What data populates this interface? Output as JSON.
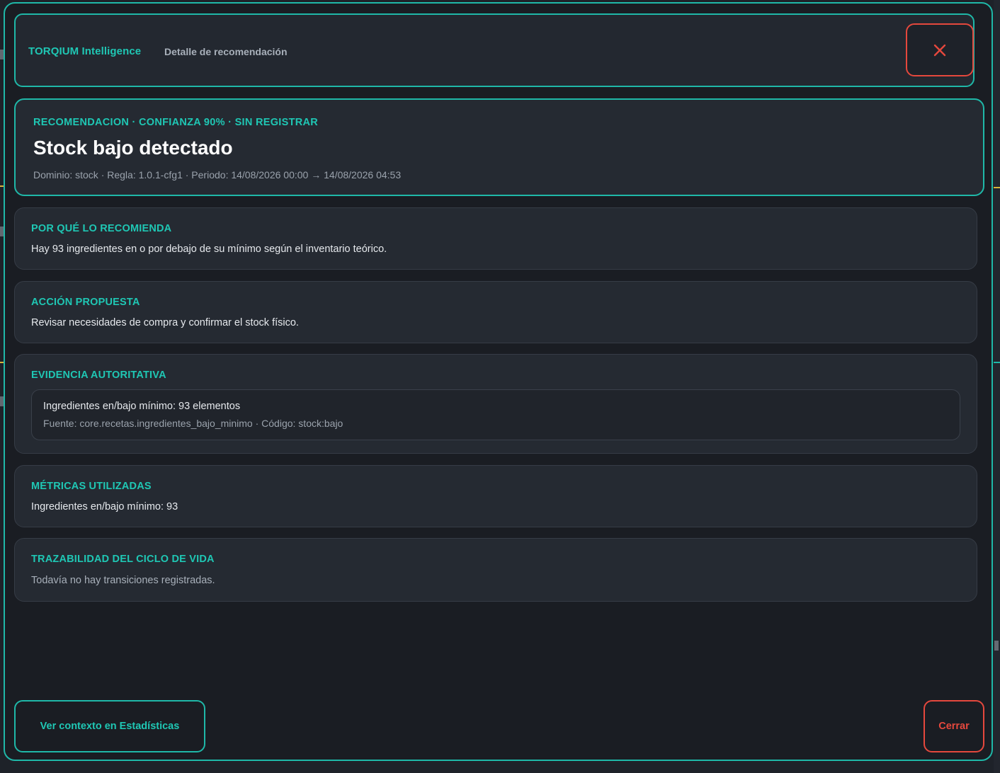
{
  "header": {
    "brand": "TORQIUM Intelligence",
    "subtitle": "Detalle de recomendación",
    "close_icon": "close-icon"
  },
  "recommendation": {
    "meta": "RECOMENDACION · CONFIANZA 90% · SIN REGISTRAR",
    "title": "Stock bajo detectado",
    "detail": "Dominio: stock · Regla: 1.0.1-cfg1 · Periodo: 14/08/2026 00:00 → 14/08/2026 04:53"
  },
  "sections": {
    "why": {
      "title": "POR QUÉ LO RECOMIENDA",
      "body": "Hay 93 ingredientes en o por debajo de su mínimo según el inventario teórico."
    },
    "action": {
      "title": "ACCIÓN PROPUESTA",
      "body": "Revisar necesidades de compra y confirmar el stock físico."
    },
    "evidence": {
      "title": "EVIDENCIA AUTORITATIVA",
      "main": "Ingredientes en/bajo mínimo: 93 elementos",
      "sub": "Fuente: core.recetas.ingredientes_bajo_minimo · Código: stock:bajo"
    },
    "metrics": {
      "title": "MÉTRICAS UTILIZADAS",
      "body": "Ingredientes en/bajo mínimo: 93"
    },
    "trace": {
      "title": "TRAZABILIDAD DEL CICLO DE VIDA",
      "body": "Todavía no hay transiciones registradas."
    }
  },
  "footer": {
    "context_button": "Ver contexto en Estadísticas",
    "close_button": "Cerrar"
  },
  "colors": {
    "accent": "#1fc7b4",
    "danger": "#e5483d",
    "background": "#1a1d23",
    "card": "#252a32"
  }
}
